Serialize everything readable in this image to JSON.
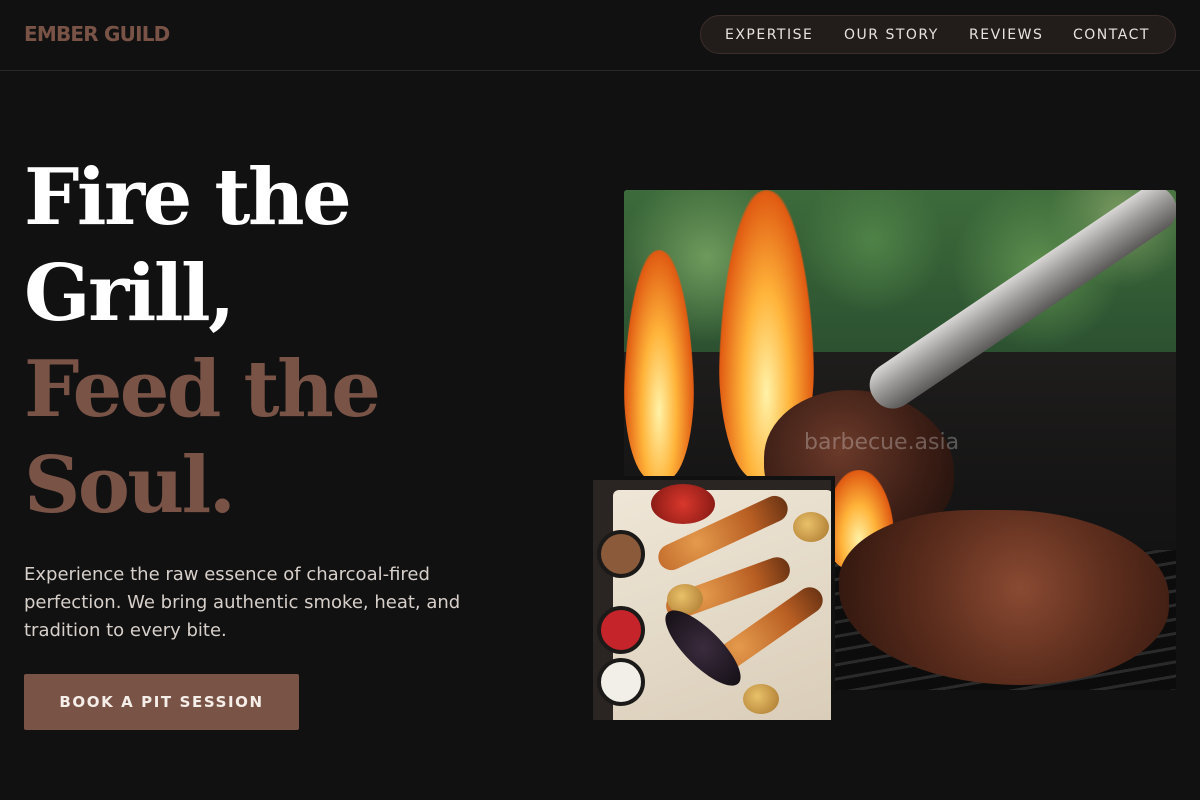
{
  "brand": {
    "logo": "EMBER GUILD"
  },
  "nav": {
    "items": [
      {
        "label": "EXPERTISE"
      },
      {
        "label": "OUR STORY"
      },
      {
        "label": "REVIEWS"
      },
      {
        "label": "CONTACT"
      }
    ]
  },
  "hero": {
    "headline": {
      "line1": "Fire the",
      "line2": "Grill,",
      "line3": "Feed the",
      "line4": "Soul."
    },
    "subtitle": "Experience the raw essence of charcoal-fired perfection. We bring authentic smoke, heat, and tradition to every bite.",
    "cta_label": "BOOK A PIT SESSION"
  },
  "images": {
    "main_watermark": "barbecue.asia"
  },
  "colors": {
    "background": "#121111",
    "accent": "#7a5347",
    "headline_light": "#ffffff",
    "body_text": "#d6cfca"
  }
}
